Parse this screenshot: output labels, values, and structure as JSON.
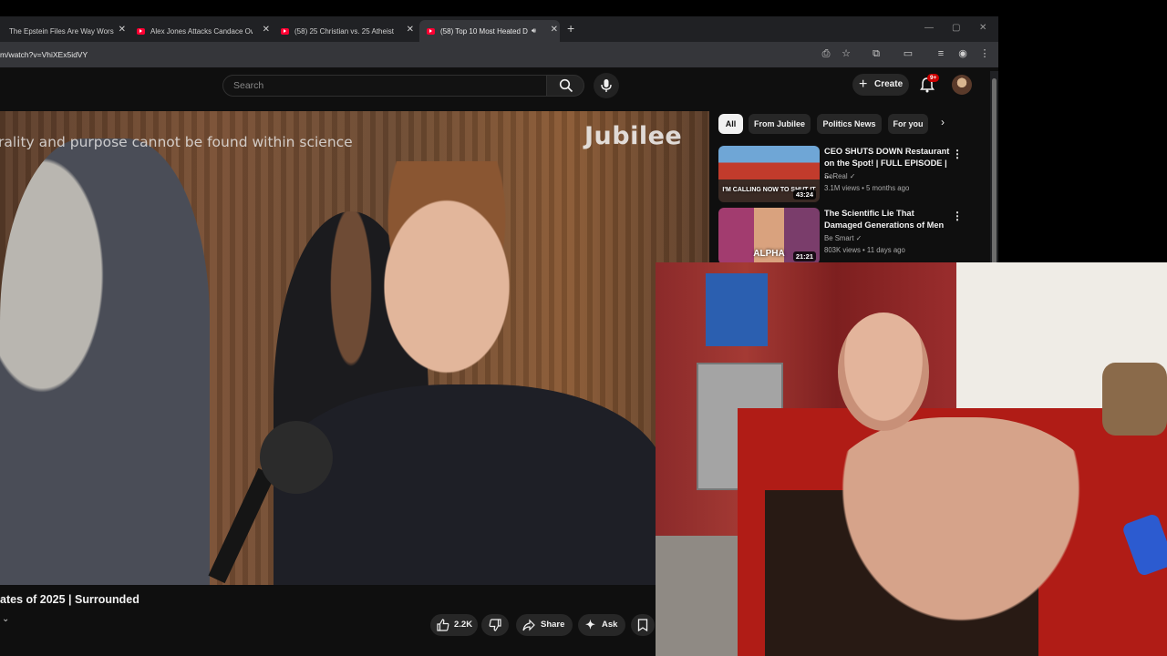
{
  "tabs": [
    {
      "title": "The Epstein Files Are Way Wors"
    },
    {
      "title": "Alex Jones Attacks Candace Ow"
    },
    {
      "title": "(58) 25 Christian vs. 25 Atheist"
    },
    {
      "title": "(58) Top 10 Most Heated De"
    }
  ],
  "address_bar": {
    "url": "m/watch?v=VhiXEx5idVY"
  },
  "masthead": {
    "search_placeholder": "Search",
    "create_label": "Create",
    "notification_badge": "9+"
  },
  "video": {
    "caption_text": "rality and purpose cannot be found within science",
    "watermark": "Jubilee",
    "title": "ates of 2025 | Surrounded",
    "like_count": "2.2K",
    "share_label": "Share",
    "ask_label": "Ask"
  },
  "chips": [
    "All",
    "From Jubilee",
    "Politics News",
    "For you"
  ],
  "recommendations": [
    {
      "title": "CEO SHUTS DOWN Restaurant on the Spot! | FULL EPISODE | ...",
      "channel": "SoReal",
      "meta": "3.1M views • 5 months ago",
      "duration": "43:24",
      "thumb_text": "I'M CALLING NOW TO SHUT IT"
    },
    {
      "title": "The Scientific Lie That Damaged Generations of Men",
      "channel": "Be Smart",
      "meta": "803K views • 11 days ago",
      "duration": "21:21",
      "thumb_text": "ALPHA"
    }
  ],
  "icons": {
    "search": "search-icon",
    "mic": "mic-icon",
    "bell": "bell-icon",
    "like": "like-icon",
    "dislike": "dislike-icon",
    "share": "share-icon",
    "ask": "sparkle-icon",
    "save": "save-icon"
  },
  "colors": {
    "youtube_red": "#ff0033",
    "bg": "#0f0f0f",
    "chip": "#272727"
  }
}
